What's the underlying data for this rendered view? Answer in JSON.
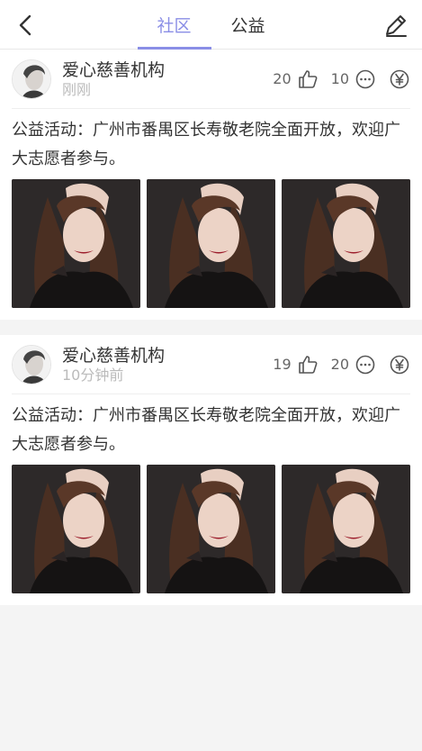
{
  "header": {
    "tabs": [
      {
        "label": "社区",
        "active": true
      },
      {
        "label": "公益",
        "active": false
      }
    ],
    "accent_color": "#8a8ee6",
    "back_icon": "chevron-left-icon",
    "edit_icon": "pencil-icon"
  },
  "posts": [
    {
      "org_name": "爱心慈善机构",
      "time": "刚刚",
      "likes": "20",
      "comments": "10",
      "content": "公益活动：广州市番禺区长寿敬老院全面开放，欢迎广大志愿者参与。",
      "photos": [
        "woman-portrait",
        "woman-portrait",
        "woman-portrait"
      ]
    },
    {
      "org_name": "爱心慈善机构",
      "time": "10分钟前",
      "likes": "19",
      "comments": "20",
      "content": "公益活动：广州市番禺区长寿敬老院全面开放，欢迎广大志愿者参与。",
      "photos": [
        "woman-portrait",
        "woman-portrait",
        "woman-portrait"
      ]
    }
  ]
}
